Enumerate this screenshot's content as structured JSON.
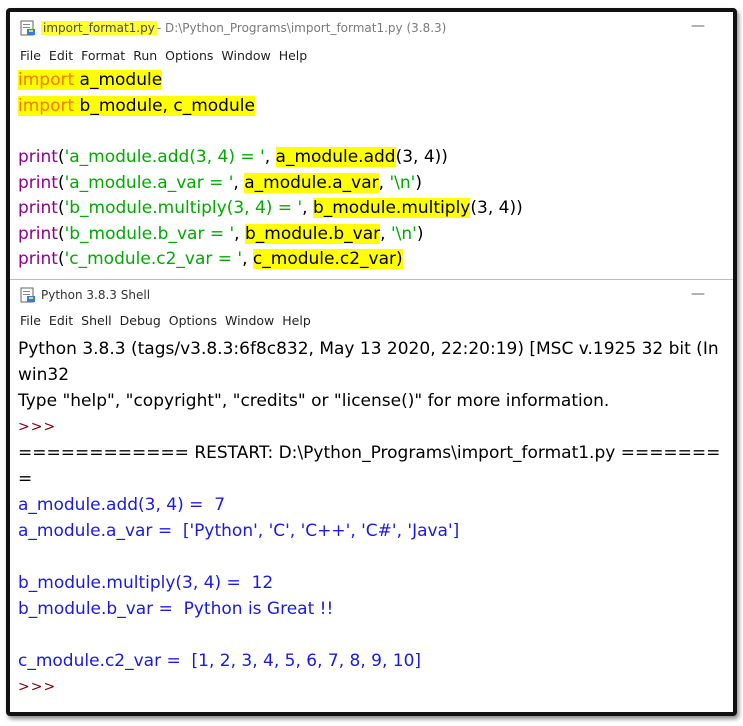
{
  "editor_window": {
    "title_file": "import_format1.py",
    "title_rest": " - D:\\Python_Programs\\import_format1.py (3.8.3)",
    "minimize": "—",
    "menu": [
      "File",
      "Edit",
      "Format",
      "Run",
      "Options",
      "Window",
      "Help"
    ],
    "code": {
      "l1_kw": "import",
      "l1_rest": " a_module",
      "l2_kw": "import",
      "l2_rest": " b_module, c_module",
      "l3_fn": "print",
      "l3_open": "(",
      "l3_str": "'a_module.add(3, 4) = '",
      "l3_sep": ", ",
      "l3_hl": "a_module.add",
      "l3_tail": "(3, 4))",
      "l4_fn": "print",
      "l4_open": "(",
      "l4_str": "'a_module.a_var = '",
      "l4_sep": ", ",
      "l4_hl": "a_module.a_var",
      "l4_sep2": ", ",
      "l4_str2": "'\\n'",
      "l4_tail": ")",
      "l5_fn": "print",
      "l5_open": "(",
      "l5_str": "'b_module.multiply(3, 4) = '",
      "l5_sep": ", ",
      "l5_hl": "b_module.multiply",
      "l5_tail": "(3, 4))",
      "l6_fn": "print",
      "l6_open": "(",
      "l6_str": "'b_module.b_var = '",
      "l6_sep": ", ",
      "l6_hl": "b_module.b_var",
      "l6_sep2": ", ",
      "l6_str2": "'\\n'",
      "l6_tail": ")",
      "l7_fn": "print",
      "l7_open": "(",
      "l7_str": "'c_module.c2_var = '",
      "l7_sep": ", ",
      "l7_hl": "c_module.c2_var)"
    }
  },
  "shell_window": {
    "title": "Python 3.8.3 Shell",
    "minimize": "—",
    "menu": [
      "File",
      "Edit",
      "Shell",
      "Debug",
      "Options",
      "Window",
      "Help"
    ],
    "lines": {
      "banner1": "Python 3.8.3 (tags/v3.8.3:6f8c832, May 13 2020, 22:20:19) [MSC v.1925 32 bit (In",
      "banner2": "win32",
      "banner3": "Type \"help\", \"copyright\", \"credits\" or \"license()\" for more information.",
      "prompt1": ">>>",
      "restart": "============ RESTART: D:\\Python_Programs\\import_format1.py =======",
      "restart_cont": "=",
      "out1": "a_module.add(3, 4) =  7",
      "out2": "a_module.a_var =  ['Python', 'C', 'C++', 'C#', 'Java']",
      "out3": "b_module.multiply(3, 4) =  12",
      "out4": "b_module.b_var =  Python is Great !!",
      "out5": "c_module.c2_var =  [1, 2, 3, 4, 5, 6, 7, 8, 9, 10]",
      "prompt2": ">>>"
    }
  }
}
